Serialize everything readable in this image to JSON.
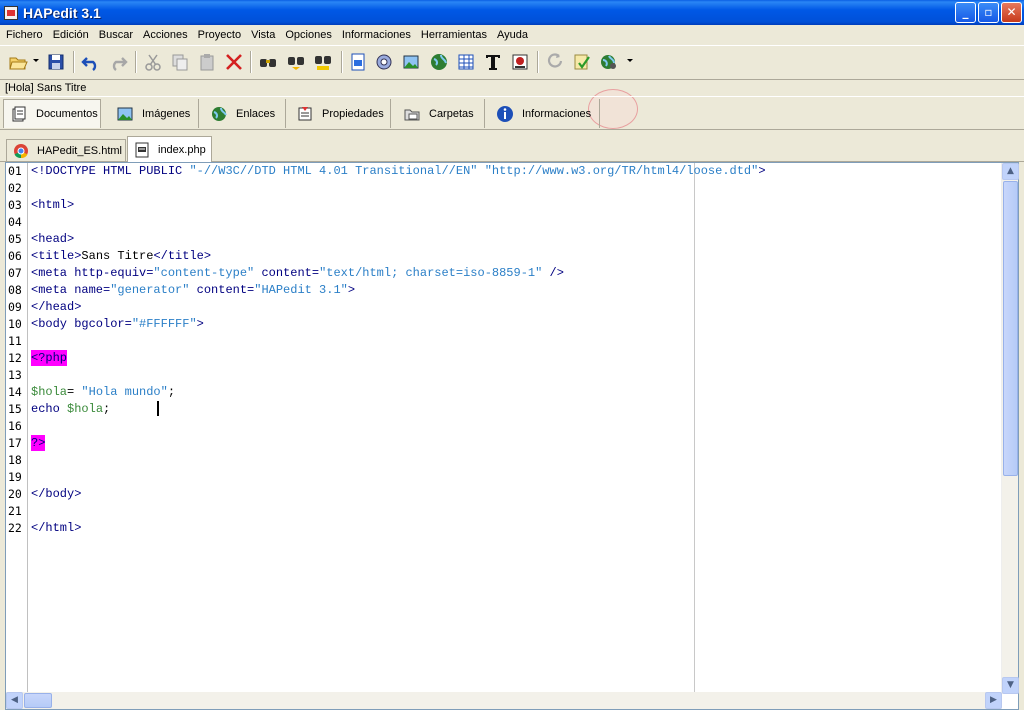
{
  "window": {
    "title": "HAPedit 3.1"
  },
  "menu": [
    "Fichero",
    "Edición",
    "Buscar",
    "Acciones",
    "Proyecto",
    "Vista",
    "Opciones",
    "Informaciones",
    "Herramientas",
    "Ayuda"
  ],
  "toolbar": {
    "icons": [
      "open-folder-icon",
      "save-icon",
      "undo-icon",
      "redo-icon",
      "cut-icon",
      "copy-icon",
      "paste-icon",
      "delete-icon",
      "find-icon",
      "replace-icon",
      "find-in-files-icon",
      "new-document-icon",
      "properties-icon",
      "image-icon",
      "web-icon",
      "table-icon",
      "text-icon",
      "color-picker-icon",
      "refresh-icon",
      "check-icon",
      "preview-icon"
    ]
  },
  "path_label": "[Hola] Sans Titre",
  "panel_tabs": [
    {
      "label": "Documentos",
      "icon": "documents-icon"
    },
    {
      "label": "Imágenes",
      "icon": "images-icon"
    },
    {
      "label": "Enlaces",
      "icon": "links-icon"
    },
    {
      "label": "Propiedades",
      "icon": "properties-icon"
    },
    {
      "label": "Carpetas",
      "icon": "folders-icon"
    },
    {
      "label": "Informaciones",
      "icon": "info-icon"
    }
  ],
  "doc_tabs": [
    {
      "label": "HAPedit_ES.html",
      "icon": "chrome-icon"
    },
    {
      "label": "index.php",
      "icon": "php-file-icon"
    }
  ],
  "editor": {
    "line_numbers": [
      "01",
      "02",
      "03",
      "04",
      "05",
      "06",
      "07",
      "08",
      "09",
      "10",
      "11",
      "12",
      "13",
      "14",
      "15",
      "16",
      "17",
      "18",
      "19",
      "20",
      "21",
      "22"
    ],
    "l01": {
      "a": "<!DOCTYPE HTML PUBLIC ",
      "b": "\"-//W3C//DTD HTML 4.01 Transitional//EN\"",
      "c": " ",
      "d": "\"http://www.w3.org/TR/html4/loose.dtd\"",
      "e": ">"
    },
    "l03": "<html>",
    "l05": "<head>",
    "l06": {
      "a": "<title>",
      "b": "Sans Titre",
      "c": "</title>"
    },
    "l07": {
      "a": "<meta http-equiv=",
      "b": "\"content-type\"",
      "c": " content=",
      "d": "\"text/html; charset=iso-8859-1\"",
      "e": " />"
    },
    "l08": {
      "a": "<meta name=",
      "b": "\"generator\"",
      "c": " content=",
      "d": "\"HAPedit 3.1\"",
      "e": ">"
    },
    "l09": "</head>",
    "l10": {
      "a": "<body bgcolor=",
      "b": "\"#FFFFFF\"",
      "c": ">"
    },
    "l12": "<?php",
    "l14": {
      "a": "$hola",
      "b": "= ",
      "c": "\"Hola mundo\"",
      "d": ";"
    },
    "l15": {
      "a": "echo ",
      "b": "$hola",
      "c": ";"
    },
    "l17": "?>",
    "l20": "</body>",
    "l22": "</html>"
  }
}
